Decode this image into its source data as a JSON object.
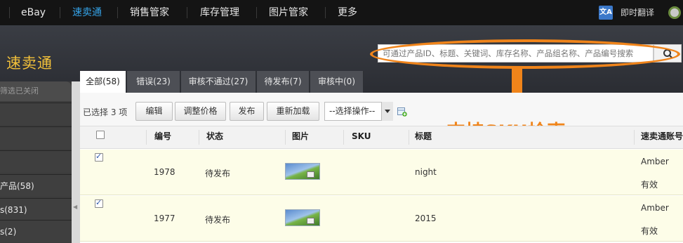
{
  "topnav": {
    "items": [
      {
        "label": "eBay",
        "active": false
      },
      {
        "label": "速卖通",
        "active": true
      },
      {
        "label": "销售管家",
        "active": false
      },
      {
        "label": "库存管理",
        "active": false
      },
      {
        "label": "图片管家",
        "active": false
      },
      {
        "label": "更多",
        "active": false
      }
    ],
    "translate_label": "即时翻译",
    "translate_icon": "translate-icon"
  },
  "brand": "速卖通",
  "search": {
    "placeholder": "可通过产品ID、标题、关键词、库存名称、产品组名称、产品编号搜索",
    "icon": "search-icon"
  },
  "annotation": {
    "text": "支持SKU检索",
    "color": "#f0841a"
  },
  "sidebar": {
    "top_text": "筛选已关闭",
    "items": [
      {
        "label": ""
      },
      {
        "label": ""
      },
      {
        "label": ""
      },
      {
        "label": "产品(58)"
      },
      {
        "label": "s(831)"
      },
      {
        "label": "s(2)"
      }
    ]
  },
  "tabs": [
    {
      "label": "全部(58)",
      "active": true
    },
    {
      "label": "错误(23)",
      "active": false
    },
    {
      "label": "审核不通过(27)",
      "active": false
    },
    {
      "label": "待发布(7)",
      "active": false
    },
    {
      "label": "审核中(0)",
      "active": false
    }
  ],
  "toolbar": {
    "selected_text": "已选择 3 项",
    "buttons": [
      "编辑",
      "调整价格",
      "发布",
      "重新加载"
    ],
    "select_value": "--选择操作--"
  },
  "table": {
    "columns": [
      "编号",
      "状态",
      "图片",
      "SKU",
      "标题",
      "速卖通账号"
    ],
    "rows": [
      {
        "checked": true,
        "id": "1978",
        "status": "待发布",
        "sku": "",
        "title": "night",
        "account": "Amber",
        "account_status": "有效"
      },
      {
        "checked": true,
        "id": "1977",
        "status": "待发布",
        "sku": "",
        "title": "2015",
        "account": "Amber",
        "account_status": "有效"
      }
    ]
  },
  "colors": {
    "accent": "#35a3e8",
    "brand": "#f3c13a",
    "annotation": "#f0841a"
  }
}
